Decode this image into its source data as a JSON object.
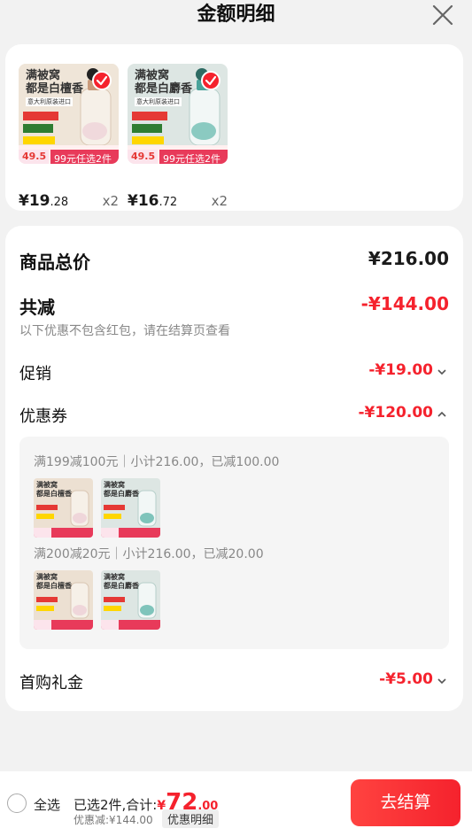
{
  "header": {
    "title": "金额明细"
  },
  "colors": {
    "accent_red": "#f5222d",
    "muted_text": "#888888"
  },
  "products": [
    {
      "variant": "white",
      "headline_line1": "满被窝",
      "headline_line2": "都是白檀香",
      "brand_tag": "意大利原装进口",
      "promo_price": "49.5",
      "promo_text": "99元任选2件",
      "price_int": "¥19",
      "price_dec": ".28",
      "qty": "x2"
    },
    {
      "variant": "teal",
      "headline_line1": "满被窝",
      "headline_line2": "都是白麝香",
      "brand_tag": "意大利原装进口",
      "promo_price": "49.5",
      "promo_text": "99元任选2件",
      "price_int": "¥16",
      "price_dec": ".72",
      "qty": "x2"
    }
  ],
  "breakdown": {
    "total_label": "商品总价",
    "total_value": "¥216.00",
    "reduce_label": "共减",
    "reduce_value": "-¥144.00",
    "note": "以下优惠不包含红包，请在结算页查看",
    "promo_label": "促销",
    "promo_value": "-¥19.00",
    "coupon_label": "优惠券",
    "coupon_value": "-¥120.00",
    "coupons": [
      {
        "text": "满199减100元｜小计216.00，已减100.00"
      },
      {
        "text": "满200减20元｜小计216.00，已减20.00"
      }
    ],
    "gift_label": "首购礼金",
    "gift_value": "-¥5.00"
  },
  "footer": {
    "select_all": "全选",
    "summary_prefix": "已选2件,合计:",
    "currency": "¥",
    "amount_int": "72",
    "amount_dec": ".00",
    "discount_text": "优惠减:¥144.00",
    "detail_tag": "优惠明细",
    "checkout": "去结算"
  }
}
